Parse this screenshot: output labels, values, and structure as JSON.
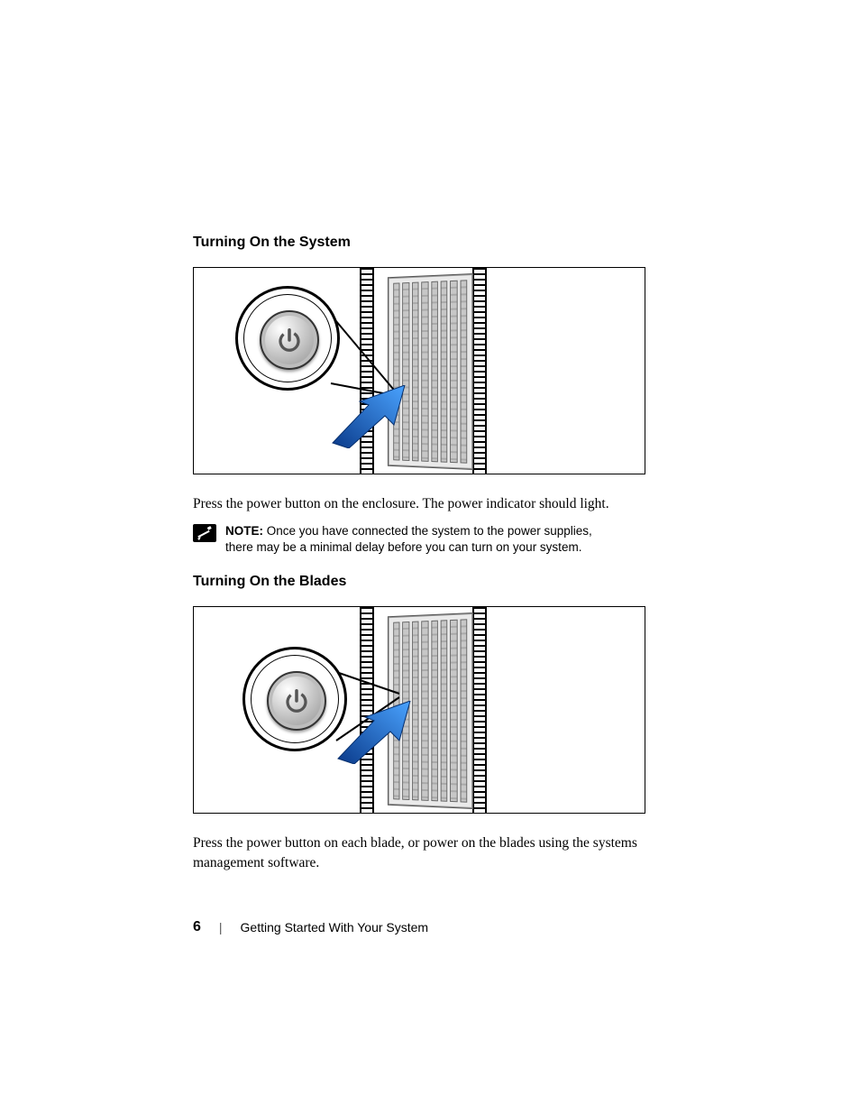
{
  "sections": {
    "system": {
      "heading": "Turning On the System",
      "body": "Press the power button on the enclosure. The power indicator should light.",
      "note_label": "NOTE:",
      "note_text": "Once you have connected the system to the power supplies, there may be a minimal delay before you can turn on your system."
    },
    "blades": {
      "heading": "Turning On the Blades",
      "body": "Press the power button on each blade, or power on the blades using the systems management software."
    }
  },
  "footer": {
    "page_number": "6",
    "chapter": "Getting Started With Your System"
  }
}
